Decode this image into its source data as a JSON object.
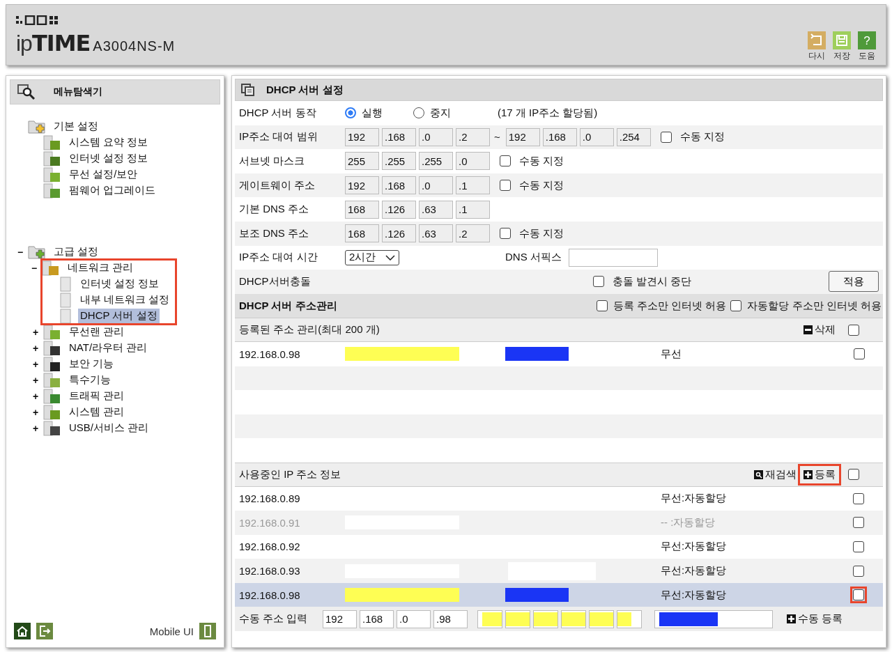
{
  "header": {
    "brand": "ip**TIME**",
    "model": "A3004NS-M",
    "actions": [
      {
        "label": "다시",
        "kind": "undo"
      },
      {
        "label": "저장",
        "kind": "save"
      },
      {
        "label": "도움",
        "kind": "help",
        "text": "?"
      }
    ]
  },
  "sidebar": {
    "title": "메뉴탐색기",
    "tree": [
      {
        "label": "기본 설정",
        "selected": false,
        "children": [
          {
            "label": "시스템 요약 정보",
            "selected": false
          },
          {
            "label": "인터넷 설정 정보",
            "selected": false
          },
          {
            "label": "무선 설정/보안",
            "selected": false
          },
          {
            "label": "펌웨어 업그레이드",
            "selected": false
          }
        ]
      },
      {
        "label": "고급 설정",
        "expander": "−",
        "selected": false,
        "children": [
          {
            "label": "네트워크 관리",
            "expander": "−",
            "selected": false,
            "highlight": true,
            "children": [
              {
                "label": "인터넷 설정 정보",
                "selected": false
              },
              {
                "label": "내부 네트워크 설정",
                "selected": false
              },
              {
                "label": "DHCP 서버 설정",
                "selected": true
              }
            ]
          },
          {
            "label": "무선랜 관리",
            "expander": "+",
            "selected": false,
            "highlight": false
          },
          {
            "label": "NAT/라우터 관리",
            "expander": "+",
            "selected": false,
            "highlight": false
          },
          {
            "label": "보안 기능",
            "expander": "+",
            "selected": false,
            "highlight": false
          },
          {
            "label": "특수기능",
            "expander": "+",
            "selected": false,
            "highlight": false
          },
          {
            "label": "트래픽 관리",
            "expander": "+",
            "selected": false,
            "highlight": false
          },
          {
            "label": "시스템 관리",
            "expander": "+",
            "selected": false,
            "highlight": false
          },
          {
            "label": "USB/서비스 관리",
            "expander": "+",
            "selected": false,
            "highlight": false
          }
        ]
      }
    ],
    "footer": {
      "mobile_label": "Mobile UI"
    }
  },
  "main": {
    "title": "DHCP 서버 설정",
    "server_action": {
      "label": "DHCP 서버 동작",
      "options": [
        {
          "label": "실행",
          "selected": true
        },
        {
          "label": "중지",
          "selected": false
        }
      ],
      "note": "(17 개 IP주소 할당됨)"
    },
    "ip_rows": [
      {
        "label": "IP주소 대여 범위",
        "fields": [
          "192",
          ".168",
          ".0",
          ".2"
        ],
        "range_sep": "~",
        "fields2": [
          "192",
          ".168",
          ".0",
          ".254"
        ],
        "manual": {
          "label": "수동 지정",
          "checked": false
        }
      },
      {
        "label": "서브넷 마스크",
        "fields": [
          "255",
          ".255",
          ".255",
          ".0"
        ],
        "manual": {
          "label": "수동 지정",
          "checked": false
        }
      },
      {
        "label": "게이트웨이 주소",
        "fields": [
          "192",
          ".168",
          ".0",
          ".1"
        ],
        "manual": {
          "label": "수동 지정",
          "checked": false
        }
      },
      {
        "label": "기본 DNS 주소",
        "fields": [
          "168",
          ".126",
          ".63",
          ".1"
        ]
      },
      {
        "label": "보조 DNS 주소",
        "fields": [
          "168",
          ".126",
          ".63",
          ".2"
        ],
        "manual": {
          "label": "수동 지정",
          "checked": false
        }
      }
    ],
    "lease": {
      "label": "IP주소 대여 시간",
      "value": "2시간",
      "dns_suffix_label": "DNS 서픽스"
    },
    "conflict": {
      "label": "DHCP서버충돌",
      "option": {
        "label": "충돌 발견시 중단",
        "checked": false
      },
      "apply": "적용"
    },
    "management": {
      "title": "DHCP 서버 주소관리",
      "options": [
        {
          "label": "등록 주소만 인터넷 허용",
          "checked": false
        },
        {
          "label": "자동할당 주소만 인터넷 허용",
          "checked": false
        }
      ]
    },
    "registered": {
      "title": "등록된 주소 관리(최대 200 개)",
      "delete": "삭제",
      "all_checked": false,
      "rows": [
        {
          "ip": "192.168.0.98",
          "marks": [
            {
              "color": "#fefe54"
            },
            {
              "color": "#1a35f5"
            }
          ],
          "type": "무선",
          "checked": false
        }
      ]
    },
    "in_use": {
      "title": "사용중인 IP 주소 정보",
      "rescan": "재검색",
      "register": {
        "label": "등록",
        "highlight": true
      },
      "all_checked": false,
      "rows": [
        {
          "ip": "192.168.0.89",
          "marks": [],
          "type": "무선:자동할당",
          "inactive": false,
          "selected": false,
          "checked": false,
          "highlight": false
        },
        {
          "ip": "192.168.0.91",
          "marks": [
            {
              "color": "#ffffff"
            }
          ],
          "type": "-- :자동할당",
          "inactive": true,
          "selected": false,
          "checked": false,
          "highlight": false
        },
        {
          "ip": "192.168.0.92",
          "marks": [],
          "type": "무선:자동할당",
          "inactive": false,
          "selected": false,
          "checked": false,
          "highlight": false
        },
        {
          "ip": "192.168.0.93",
          "marks": [
            {
              "color": "#ffffff"
            },
            {
              "color": "#ffffff"
            }
          ],
          "type": "무선:자동할당",
          "inactive": false,
          "selected": false,
          "checked": false,
          "highlight": false
        },
        {
          "ip": "192.168.0.98",
          "marks": [
            {
              "color": "#fefe54"
            },
            {
              "color": "#1a35f5"
            }
          ],
          "type": "무선:자동할당",
          "inactive": false,
          "selected": true,
          "checked": false,
          "highlight": true
        }
      ]
    },
    "manual_entry": {
      "label": "수동 주소 입력",
      "ip": [
        "192",
        ".168",
        ".0",
        ".98"
      ],
      "mac_mark": {
        "color": "#fefe54"
      },
      "name_mark": {
        "color": "#1a35f5"
      },
      "submit": "수동 등록"
    }
  }
}
